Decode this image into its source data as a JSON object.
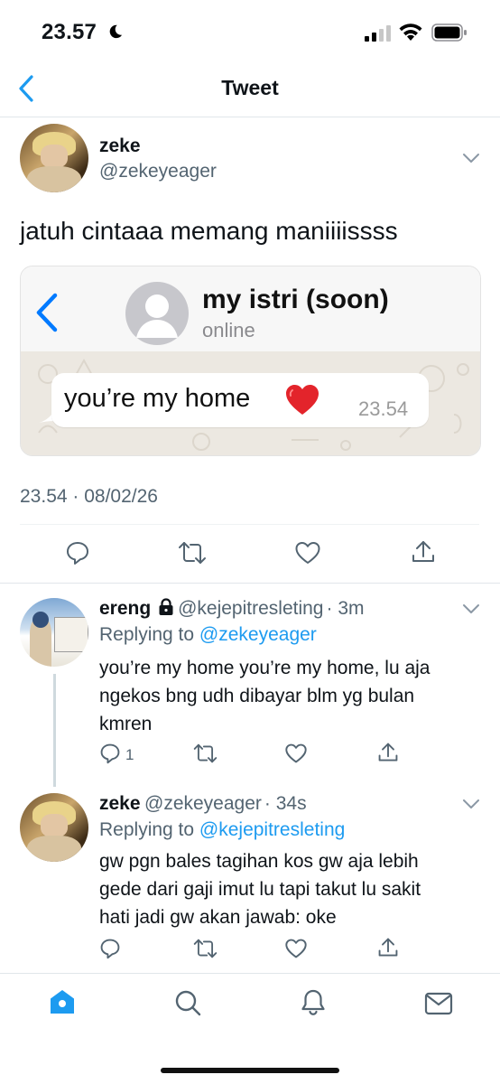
{
  "status_bar": {
    "time": "23.57"
  },
  "nav": {
    "title": "Tweet"
  },
  "tweet": {
    "name": "zeke",
    "handle": "@zekeyeager",
    "text": "jatuh cintaaa memang maniiiissss",
    "timestamp": "23.54 · 08/02/26",
    "embedded_chat": {
      "contact_name": "my istri (soon)",
      "contact_status": "online",
      "message": "you’re my home",
      "message_time": "23.54"
    }
  },
  "replies": [
    {
      "name": "ereng",
      "handle": "@kejepitresleting",
      "time": "· 3m",
      "replying_prefix": "Replying to",
      "replying_to": "@zekeyeager",
      "lines": [
        "you’re my home you’re my home, lu aja",
        "ngekos bng udh dibayar blm yg bulan",
        "kmren"
      ],
      "reply_count": "1"
    },
    {
      "name": "zeke",
      "handle": "@zekeyeager",
      "time": "· 34s",
      "replying_prefix": "Replying to",
      "replying_to": "@kejepitresleting",
      "lines": [
        "gw pgn bales tagihan kos gw aja lebih",
        "gede dari gaji imut lu tapi takut lu sakit",
        "hati jadi gw akan jawab: oke"
      ]
    }
  ],
  "icons": {
    "status": [
      "moon-icon",
      "signal-icon",
      "wifi-icon",
      "battery-icon"
    ],
    "actions": [
      "reply-icon",
      "retweet-icon",
      "like-icon",
      "share-icon"
    ],
    "tabs": [
      "home-icon",
      "search-icon",
      "notifications-icon",
      "messages-icon"
    ]
  },
  "colors": {
    "accent": "#1d9bf0",
    "text": "#0f1419",
    "secondary": "#536471",
    "chat_accent": "#007aff"
  }
}
